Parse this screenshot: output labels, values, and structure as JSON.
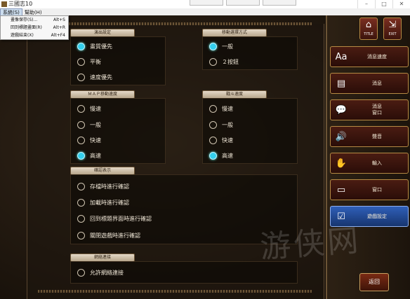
{
  "window": {
    "title": "三國志10"
  },
  "menubar": {
    "items": [
      {
        "label": "系統(S)"
      },
      {
        "label": "幫助(H)"
      }
    ]
  },
  "menu_dropdown": {
    "items": [
      {
        "label": "畫像保存(S)...",
        "shortcut": "Alt+S"
      },
      {
        "label": "回到標題畫面(R)",
        "shortcut": "Alt+R"
      },
      {
        "label": "遊戲結束(X)",
        "shortcut": "Alt+F4"
      }
    ]
  },
  "sections": {
    "display": {
      "title": "演出設定",
      "options": [
        {
          "label": "畫質優先",
          "selected": true
        },
        {
          "label": "平衡",
          "selected": false
        },
        {
          "label": "速度優先",
          "selected": false
        }
      ]
    },
    "control": {
      "title": "移動選擇方式",
      "options": [
        {
          "label": "一般",
          "selected": true
        },
        {
          "label": "２按鈕",
          "selected": false
        }
      ]
    },
    "map_speed": {
      "title": "ＭＡＰ移動速度",
      "options": [
        {
          "label": "慢速",
          "selected": false
        },
        {
          "label": "一般",
          "selected": false
        },
        {
          "label": "快速",
          "selected": false
        },
        {
          "label": "高速",
          "selected": true
        }
      ]
    },
    "battle_speed": {
      "title": "戰斗速度",
      "options": [
        {
          "label": "慢速",
          "selected": false
        },
        {
          "label": "一般",
          "selected": false
        },
        {
          "label": "快速",
          "selected": false
        },
        {
          "label": "高速",
          "selected": true
        }
      ]
    },
    "confirm": {
      "title": "確認表示",
      "options": [
        {
          "label": "存檔時進行確認",
          "selected": false
        },
        {
          "label": "加載時進行確認",
          "selected": false
        },
        {
          "label": "回到標題界面時進行確認",
          "selected": false
        },
        {
          "label": "關閉遊戲時進行確認",
          "selected": false
        }
      ]
    },
    "network": {
      "title": "網絡連接",
      "options": [
        {
          "label": "允許網絡連接",
          "selected": false
        }
      ]
    }
  },
  "top_icons": [
    {
      "label": "TITLE",
      "icon": "home-icon"
    },
    {
      "label": "EXIT",
      "icon": "exit-icon"
    }
  ],
  "sidebar": {
    "items": [
      {
        "label": "消息速度",
        "icon": "text-size-icon",
        "active": false
      },
      {
        "label": "消息",
        "icon": "document-icon",
        "active": false
      },
      {
        "label": "消息\n窗口",
        "icon": "speech-bubble-icon",
        "active": false
      },
      {
        "label": "聲音",
        "icon": "speaker-icon",
        "active": false
      },
      {
        "label": "輸入",
        "icon": "hand-icon",
        "active": false
      },
      {
        "label": "窗口",
        "icon": "monitor-icon",
        "active": false
      },
      {
        "label": "遊戲設定",
        "icon": "checkbox-icon",
        "active": true
      }
    ]
  },
  "back_button": {
    "label": "返回"
  },
  "colors": {
    "accent": "#33d0ee",
    "frame": "#b68a43",
    "active_tab": "#2f5fb8"
  }
}
